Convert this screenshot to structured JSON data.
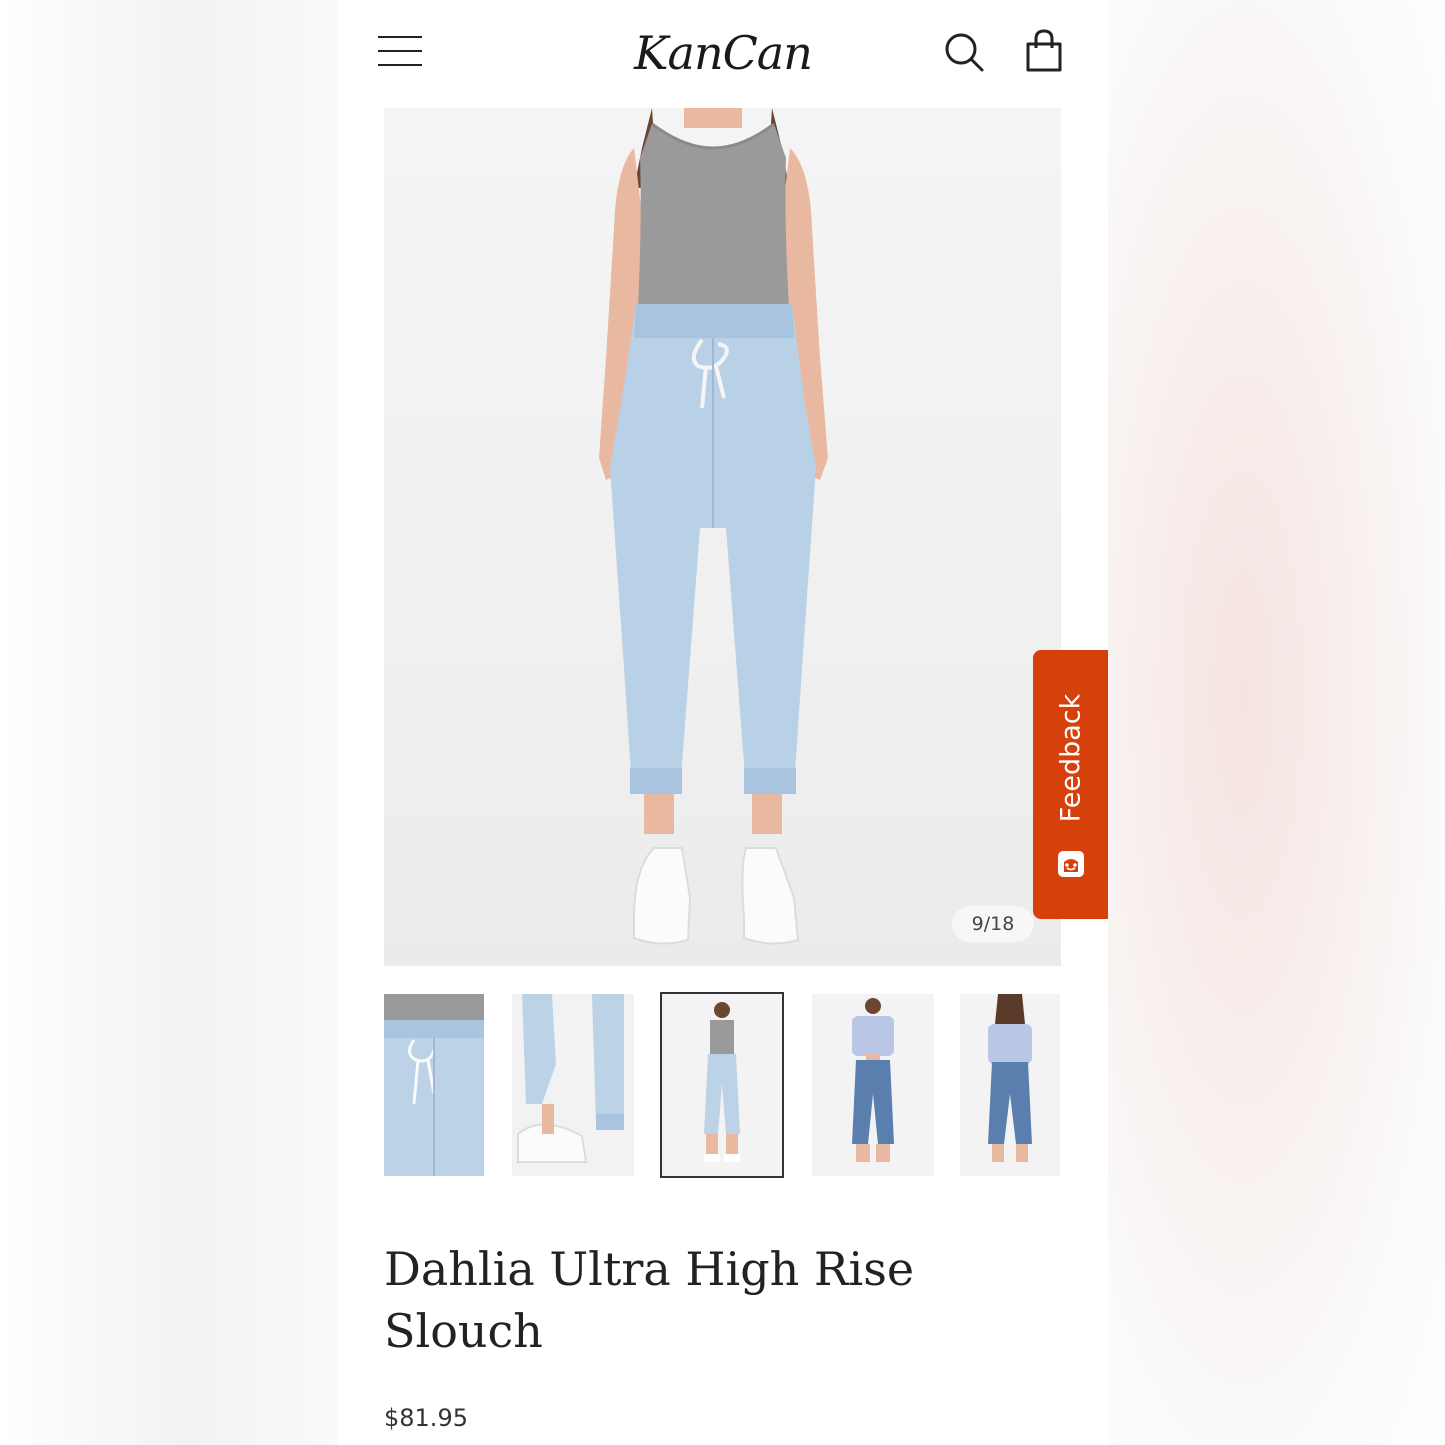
{
  "header": {
    "logo_text": "KanCan",
    "menu_icon": "hamburger-menu-icon",
    "search_icon": "search-icon",
    "bag_icon": "shopping-bag-icon"
  },
  "gallery": {
    "counter": "9/18",
    "current_index": 9,
    "total": 18,
    "thumbnails": [
      {
        "name": "thumb-drawstring-closeup"
      },
      {
        "name": "thumb-cuff-sneakers"
      },
      {
        "name": "thumb-front-full",
        "active": true
      },
      {
        "name": "thumb-front-cropped-top"
      },
      {
        "name": "thumb-back-view"
      }
    ]
  },
  "feedback": {
    "label": "Feedback",
    "icon": "smiley-face-icon",
    "color": "#d6400b"
  },
  "product": {
    "title": "Dahlia Ultra High Rise Slouch",
    "price": "$81.95"
  }
}
